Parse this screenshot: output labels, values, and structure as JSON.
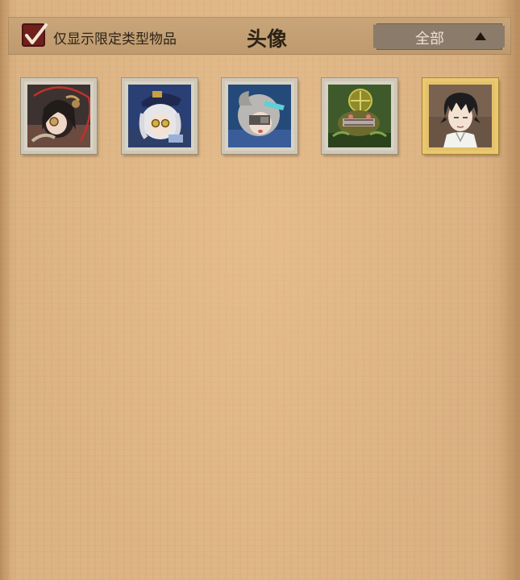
{
  "header": {
    "filter_label": "仅显示限定类型物品",
    "filter_checked": true,
    "title": "头像",
    "dropdown": {
      "selected": "全部"
    }
  },
  "colors": {
    "background": "#dcb080",
    "header_bar": "#c4a074",
    "checkbox": "#6f1f1c",
    "dropdown": "#8b7b6a",
    "gold_frame": "#e4c16a"
  },
  "avatars": [
    {
      "name": "avatar-1",
      "icon": "dark-haired-character-portrait-icon",
      "frame": "silver",
      "marked": true
    },
    {
      "name": "avatar-2",
      "icon": "white-haired-officer-portrait-icon",
      "frame": "silver",
      "marked": false
    },
    {
      "name": "avatar-3",
      "icon": "masked-grey-haired-portrait-icon",
      "frame": "silver",
      "marked": false
    },
    {
      "name": "avatar-4",
      "icon": "green-mechanical-creature-portrait-icon",
      "frame": "silver",
      "marked": false
    },
    {
      "name": "avatar-5",
      "icon": "black-haired-boy-portrait-icon",
      "frame": "gold",
      "marked": false
    }
  ]
}
